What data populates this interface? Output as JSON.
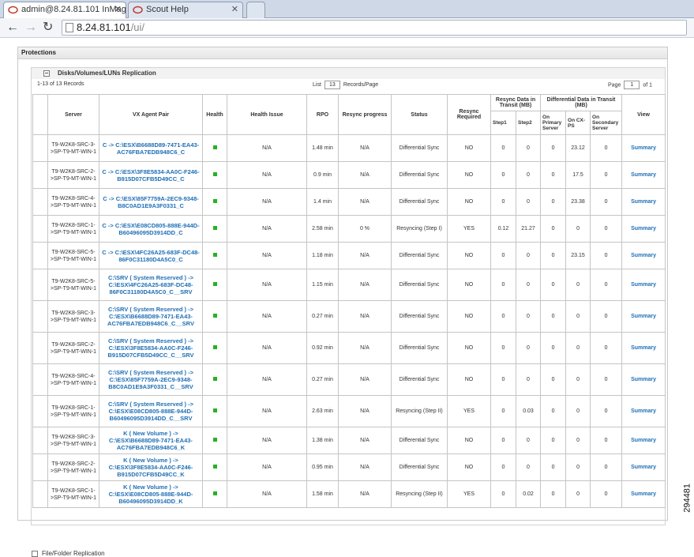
{
  "browser": {
    "tabs": [
      {
        "label": "admin@8.24.81.101 InMage",
        "active": true
      },
      {
        "label": "Scout Help",
        "active": false
      },
      {
        "label": "",
        "active": false
      }
    ],
    "address": {
      "host": "8.24.81.101",
      "path": "/ui/"
    }
  },
  "page": {
    "protections_title": "Protections",
    "section_title": "Disks/Volumes/LUNs Replication",
    "records_text": "1-13 of 13 Records",
    "list_label": "List",
    "list_value": "13",
    "records_per_page": "Records/Page",
    "page_label": "Page",
    "page_value": "1",
    "page_of": "of 1",
    "file_folder_title": "File/Folder Replication"
  },
  "table": {
    "headers": {
      "server": "Server",
      "pair": "VX Agent Pair",
      "health": "Health",
      "issue": "Health Issue",
      "rpo": "RPO",
      "progress": "Resync progress",
      "status": "Status",
      "required": "Resync Required",
      "resync_group": "Resync Data in Transit (MB)",
      "step1": "Step1",
      "step2": "Step2",
      "diff_group": "Differential Data in Transit (MB)",
      "primary": "On Primary Server",
      "cxps": "On CX-PS",
      "secondary": "On Secondary Server",
      "view": "View"
    },
    "rows": [
      {
        "server": "T9-W2K8-SRC-3->SP-T9-MT-WIN-1",
        "pair": "C -> C:\\ESX\\B6688D89-7471-EA43-AC76FBA7EDB948C6_C",
        "issue": "N/A",
        "rpo": "1.48 min",
        "progress": "N/A",
        "status": "Differential Sync",
        "required": "NO",
        "step1": "0",
        "step2": "0",
        "primary": "0",
        "cxps": "23.12",
        "secondary": "0",
        "view": "Summary"
      },
      {
        "server": "T9-W2K8-SRC-2->SP-T9-MT-WIN-1",
        "pair": "C -> C:\\ESX\\3F8E5834-AA0C-F246-B915D07CFB5D49CC_C",
        "issue": "N/A",
        "rpo": "0.9 min",
        "progress": "N/A",
        "status": "Differential Sync",
        "required": "NO",
        "step1": "0",
        "step2": "0",
        "primary": "0",
        "cxps": "17.5",
        "secondary": "0",
        "view": "Summary"
      },
      {
        "server": "T9-W2K8-SRC-4->SP-T9-MT-WIN-1",
        "pair": "C -> C:\\ESX\\85F7759A-2EC9-9348-B8C0AD1E9A3F0331_C",
        "issue": "N/A",
        "rpo": "1.4 min",
        "progress": "N/A",
        "status": "Differential Sync",
        "required": "NO",
        "step1": "0",
        "step2": "0",
        "primary": "0",
        "cxps": "23.38",
        "secondary": "0",
        "view": "Summary"
      },
      {
        "server": "T9-W2K8-SRC-1->SP-T9-MT-WIN-1",
        "pair": "C -> C:\\ESX\\E08CD805-888E-944D-B60496095D3914DD_C",
        "issue": "N/A",
        "rpo": "2.58 min",
        "progress": "0 %",
        "status": "Resyncing (Step I)",
        "required": "YES",
        "step1": "0.12",
        "step2": "21.27",
        "primary": "0",
        "cxps": "0",
        "secondary": "0",
        "view": "Summary"
      },
      {
        "server": "T9-W2K8-SRC-5->SP-T9-MT-WIN-1",
        "pair": "C -> C:\\ESX\\4FC26A25-683F-DC48-86F0C31180D4A5C0_C",
        "issue": "N/A",
        "rpo": "1.18 min",
        "progress": "N/A",
        "status": "Differential Sync",
        "required": "NO",
        "step1": "0",
        "step2": "0",
        "primary": "0",
        "cxps": "23.15",
        "secondary": "0",
        "view": "Summary"
      },
      {
        "server": "T9-W2K8-SRC-5->SP-T9-MT-WIN-1",
        "pair": "C:\\SRV ( System Reserved ) -> C:\\ESX\\4FC26A25-683F-DC48-86F0C31180D4A5C0_C__SRV",
        "issue": "N/A",
        "rpo": "1.15 min",
        "progress": "N/A",
        "status": "Differential Sync",
        "required": "NO",
        "step1": "0",
        "step2": "0",
        "primary": "0",
        "cxps": "0",
        "secondary": "0",
        "view": "Summary"
      },
      {
        "server": "T9-W2K8-SRC-3->SP-T9-MT-WIN-1",
        "pair": "C:\\SRV ( System Reserved ) -> C:\\ESX\\B6688D89-7471-EA43-AC76FBA7EDB948C6_C__SRV",
        "issue": "N/A",
        "rpo": "0.27 min",
        "progress": "N/A",
        "status": "Differential Sync",
        "required": "NO",
        "step1": "0",
        "step2": "0",
        "primary": "0",
        "cxps": "0",
        "secondary": "0",
        "view": "Summary"
      },
      {
        "server": "T9-W2K8-SRC-2->SP-T9-MT-WIN-1",
        "pair": "C:\\SRV ( System Reserved ) -> C:\\ESX\\3F8E5834-AA0C-F246-B915D07CFB5D49CC_C__SRV",
        "issue": "N/A",
        "rpo": "0.92 min",
        "progress": "N/A",
        "status": "Differential Sync",
        "required": "NO",
        "step1": "0",
        "step2": "0",
        "primary": "0",
        "cxps": "0",
        "secondary": "0",
        "view": "Summary"
      },
      {
        "server": "T9-W2K8-SRC-4->SP-T9-MT-WIN-1",
        "pair": "C:\\SRV ( System Reserved ) -> C:\\ESX\\85F7759A-2EC9-9348-B8C0AD1E9A3F0331_C__SRV",
        "issue": "N/A",
        "rpo": "0.27 min",
        "progress": "N/A",
        "status": "Differential Sync",
        "required": "NO",
        "step1": "0",
        "step2": "0",
        "primary": "0",
        "cxps": "0",
        "secondary": "0",
        "view": "Summary"
      },
      {
        "server": "T9-W2K8-SRC-1->SP-T9-MT-WIN-1",
        "pair": "C:\\SRV ( System Reserved ) -> C:\\ESX\\E08CD805-888E-944D-B60496095D3914DD_C__SRV",
        "issue": "N/A",
        "rpo": "2.63 min",
        "progress": "N/A",
        "status": "Resyncing (Step II)",
        "required": "YES",
        "step1": "0",
        "step2": "0.03",
        "primary": "0",
        "cxps": "0",
        "secondary": "0",
        "view": "Summary"
      },
      {
        "server": "T9-W2K8-SRC-3->SP-T9-MT-WIN-1",
        "pair": "K ( New Volume ) -> C:\\ESX\\B6688D89-7471-EA43-AC76FBA7EDB948C6_K",
        "issue": "N/A",
        "rpo": "1.38 min",
        "progress": "N/A",
        "status": "Differential Sync",
        "required": "NO",
        "step1": "0",
        "step2": "0",
        "primary": "0",
        "cxps": "0",
        "secondary": "0",
        "view": "Summary"
      },
      {
        "server": "T9-W2K8-SRC-2->SP-T9-MT-WIN-1",
        "pair": "K ( New Volume ) -> C:\\ESX\\3F8E5834-AA0C-F246-B915D07CFB5D49CC_K",
        "issue": "N/A",
        "rpo": "0.95 min",
        "progress": "N/A",
        "status": "Differential Sync",
        "required": "NO",
        "step1": "0",
        "step2": "0",
        "primary": "0",
        "cxps": "0",
        "secondary": "0",
        "view": "Summary"
      },
      {
        "server": "T9-W2K8-SRC-1->SP-T9-MT-WIN-1",
        "pair": "K ( New Volume ) -> C:\\ESX\\E08CD805-888E-944D-B60496095D3914DD_K",
        "issue": "N/A",
        "rpo": "1.58 min",
        "progress": "N/A",
        "status": "Resyncing (Step II)",
        "required": "YES",
        "step1": "0",
        "step2": "0.02",
        "primary": "0",
        "cxps": "0",
        "secondary": "0",
        "view": "Summary"
      }
    ]
  },
  "colors": {
    "link": "#1f6fb5",
    "health_ok": "#27b127"
  },
  "side_label": "294481"
}
